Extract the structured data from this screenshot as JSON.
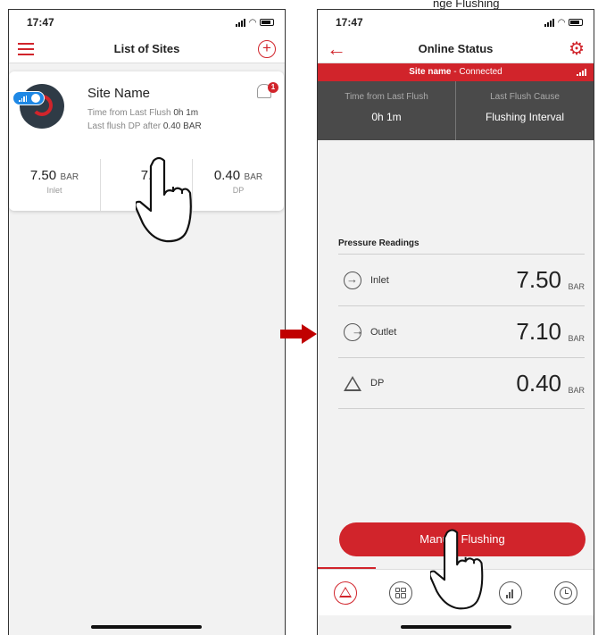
{
  "annotation_top": "nge Flushing",
  "left_screen": {
    "status_time": "17:47",
    "nav_title": "List of Sites",
    "site_card": {
      "name": "Site Name",
      "flush_time_label": "Time from Last Flush",
      "flush_time_value": "0h 1m",
      "flush_dp_label": "Last flush DP after",
      "flush_dp_value": "0.40 BAR",
      "notification_count": "1",
      "metrics": [
        {
          "value": "7.50",
          "unit": "BAR",
          "label": "Inlet"
        },
        {
          "value": "7.",
          "unit": "",
          "label": ""
        },
        {
          "value": "0.40",
          "unit": "BAR",
          "label": "DP"
        }
      ]
    }
  },
  "right_screen": {
    "status_time": "17:47",
    "nav_title": "Online Status",
    "banner_site": "Site name",
    "banner_status": " - Connected",
    "flush_info": [
      {
        "label": "Time from Last Flush",
        "value": "0h 1m"
      },
      {
        "label": "Last Flush Cause",
        "value": "Flushing Interval"
      }
    ],
    "readings_title": "Pressure Readings",
    "readings": [
      {
        "icon": "inlet-arrow-icon",
        "label": "Inlet",
        "value": "7.50",
        "unit": "BAR"
      },
      {
        "icon": "outlet-arrow-icon",
        "label": "Outlet",
        "value": "7.10",
        "unit": "BAR"
      },
      {
        "icon": "delta-icon",
        "label": "DP",
        "value": "0.40",
        "unit": "BAR"
      }
    ],
    "manual_flush_label": "Manual Flushing",
    "tabs": [
      "status-tab-icon",
      "dashboard-tab-icon",
      "reports-tab-icon",
      "statistics-tab-icon",
      "history-tab-icon"
    ]
  },
  "colors": {
    "accent": "#d1242b",
    "dark_panel": "#4a4a4a",
    "annotation_arrow": "#c00000",
    "link_blue": "#1e88e5"
  }
}
